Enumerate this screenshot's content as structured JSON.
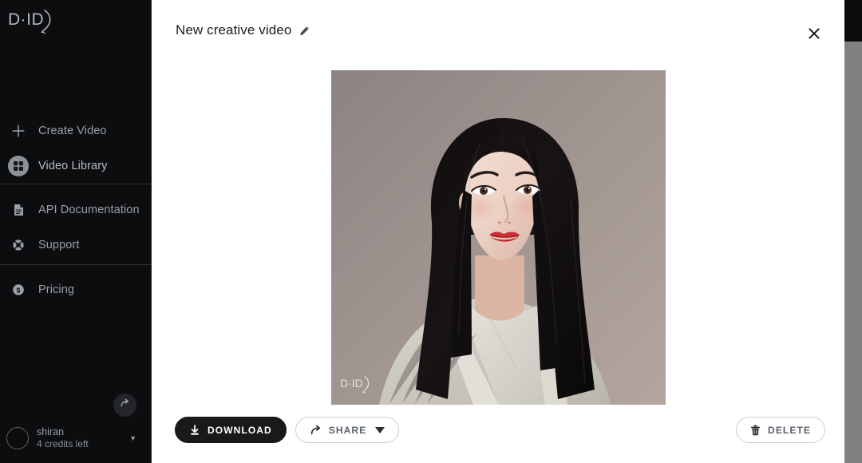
{
  "app": {
    "brand": "D-ID",
    "brand_logo_icon": "did-logo-icon"
  },
  "sidebar": {
    "groups": [
      {
        "name": "primary",
        "items": [
          {
            "label": "Create Video",
            "icon": "plus-icon",
            "active": false
          },
          {
            "label": "Video Library",
            "icon": "grid-icon",
            "active": true
          }
        ]
      },
      {
        "name": "resources",
        "items": [
          {
            "label": "API Documentation",
            "icon": "document-icon",
            "active": false
          },
          {
            "label": "Support",
            "icon": "lifebuoy-icon",
            "active": false
          }
        ]
      },
      {
        "name": "billing",
        "items": [
          {
            "label": "Pricing",
            "icon": "dollar-circle-icon",
            "active": false
          }
        ]
      }
    ],
    "toggle_icon": "expand-arrow-icon",
    "user": {
      "name": "shiran",
      "credits": "4 credits left",
      "avatar_icon": "avatar-icon",
      "caret_icon": "chevron-down-icon"
    }
  },
  "modal": {
    "title": "New creative video",
    "edit_icon": "pencil-icon",
    "close_icon": "close-icon",
    "media": {
      "type": "image",
      "alt": "Portrait of a woman with long black hair and red lipstick wearing a light gray cardigan",
      "watermark": "D-ID"
    },
    "actions": {
      "download": {
        "label": "DOWNLOAD",
        "icon": "download-icon",
        "style": "primary"
      },
      "share": {
        "label": "SHARE",
        "icon": "share-icon",
        "caret_icon": "caret-down-icon",
        "style": "outline"
      },
      "delete": {
        "label": "DELETE",
        "icon": "trash-icon",
        "style": "outline"
      }
    }
  },
  "colors": {
    "sidebar_bg": "#0c0d0f",
    "main_bg": "#ffffff",
    "primary_button_bg": "#17191b",
    "muted_text": "#9aa0a6",
    "active_icon_bg": "#8d9297",
    "scrollbar": "#808080"
  }
}
